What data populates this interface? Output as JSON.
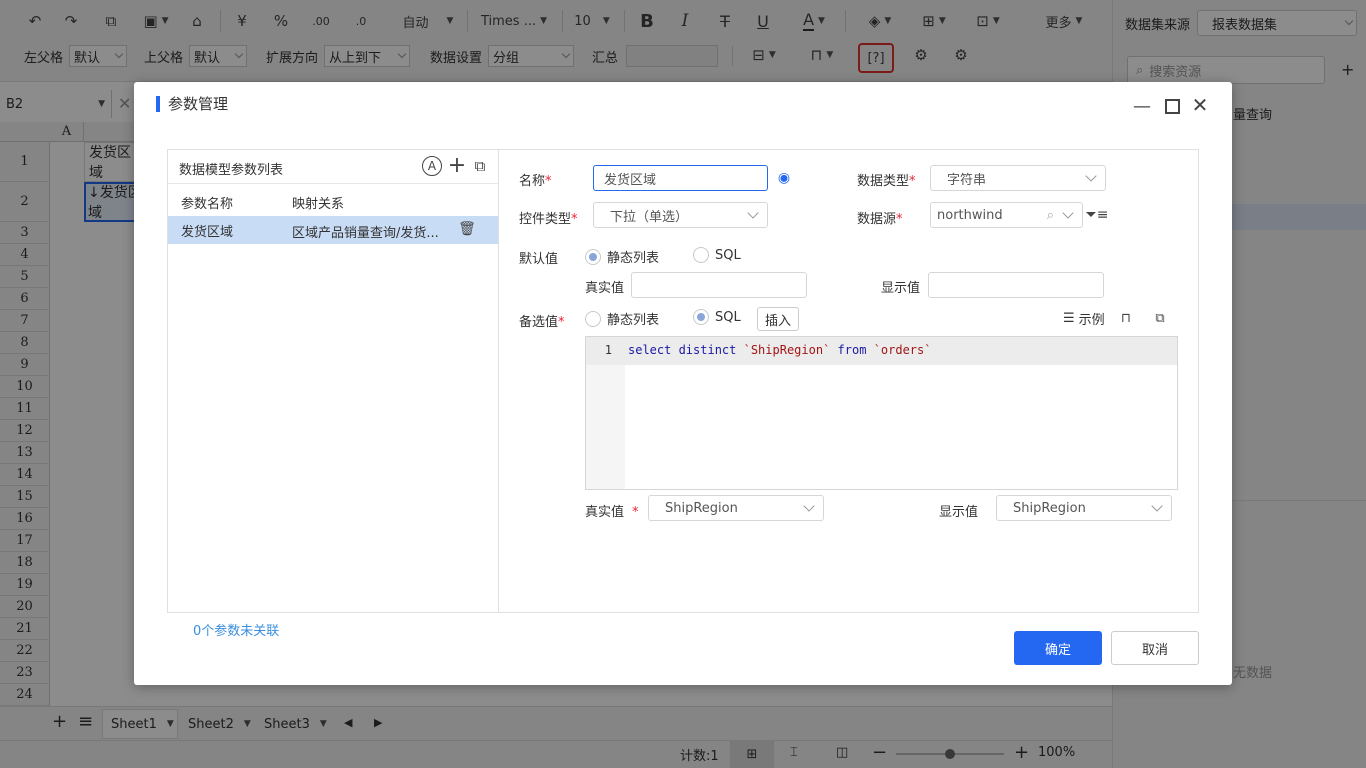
{
  "toolbar": {
    "row1": {
      "format_auto": "自动",
      "font_name": "Times ...",
      "font_size": "10",
      "more_label": "更多",
      "yen": "¥",
      "percent": "%",
      "dec_inc": ".00",
      "dec_dec": ".0"
    },
    "row2": {
      "left_parent_label": "左父格",
      "left_parent_value": "默认",
      "top_parent_label": "上父格",
      "top_parent_value": "默认",
      "expand_label": "扩展方向",
      "expand_value": "从上到下",
      "data_setting_label": "数据设置",
      "data_setting_value": "分组",
      "summary_label": "汇总",
      "summary_value": ""
    }
  },
  "sheet": {
    "cell_ref": "B2",
    "col_a": "A",
    "cell_b1": "发货区域",
    "cell_b2": "↓发货区域",
    "rows": [
      "1",
      "2",
      "3",
      "4",
      "5",
      "6",
      "7",
      "8",
      "9",
      "10",
      "11",
      "12",
      "13",
      "14",
      "15",
      "16",
      "17",
      "18",
      "19",
      "20",
      "21",
      "22",
      "23",
      "24"
    ]
  },
  "right_panel": {
    "source_label": "数据集来源",
    "source_value": "报表数据集",
    "search_placeholder": "搜索资源",
    "partial_item": "量查询",
    "partial_bottom": "无数据"
  },
  "sheet_tabs": [
    "Sheet1",
    "Sheet2",
    "Sheet3"
  ],
  "status": {
    "count": "计数:1",
    "zoom": "100%"
  },
  "dialog": {
    "title": "参数管理",
    "left": {
      "title": "数据模型参数列表",
      "col_name": "参数名称",
      "col_map": "映射关系",
      "rows": [
        {
          "name": "发货区域",
          "map": "区域产品销量查询/发货..."
        }
      ],
      "footer_link": "0个参数未关联"
    },
    "form": {
      "name_label": "名称",
      "name_value": "发货区域",
      "datatype_label": "数据类型",
      "datatype_value": "字符串",
      "control_label": "控件类型",
      "control_value": "下拉（单选）",
      "datasource_label": "数据源",
      "datasource_value": "northwind",
      "default_label": "默认值",
      "default_opt_static": "静态列表",
      "default_opt_sql": "SQL",
      "real_value_label": "真实值",
      "display_value_label": "显示值",
      "candidate_label": "备选值",
      "cand_opt_static": "静态列表",
      "cand_opt_sql": "SQL",
      "insert_button": "插入",
      "example_label": "示例",
      "sql_line_no": "1",
      "sql_kw1": "select distinct",
      "sql_str1": "`ShipRegion`",
      "sql_kw2": "from",
      "sql_str2": "`orders`",
      "bottom_real_label": "真实值",
      "bottom_real_value": "ShipRegion",
      "bottom_display_label": "显示值",
      "bottom_display_value": "ShipRegion"
    },
    "ok_button": "确定",
    "cancel_button": "取消"
  },
  "colors": {
    "accent": "#2468f2",
    "selected_row": "#c9dcf5",
    "required": "#e23333",
    "sql_keyword": "#1a1aa6",
    "sql_string": "#a31515"
  }
}
